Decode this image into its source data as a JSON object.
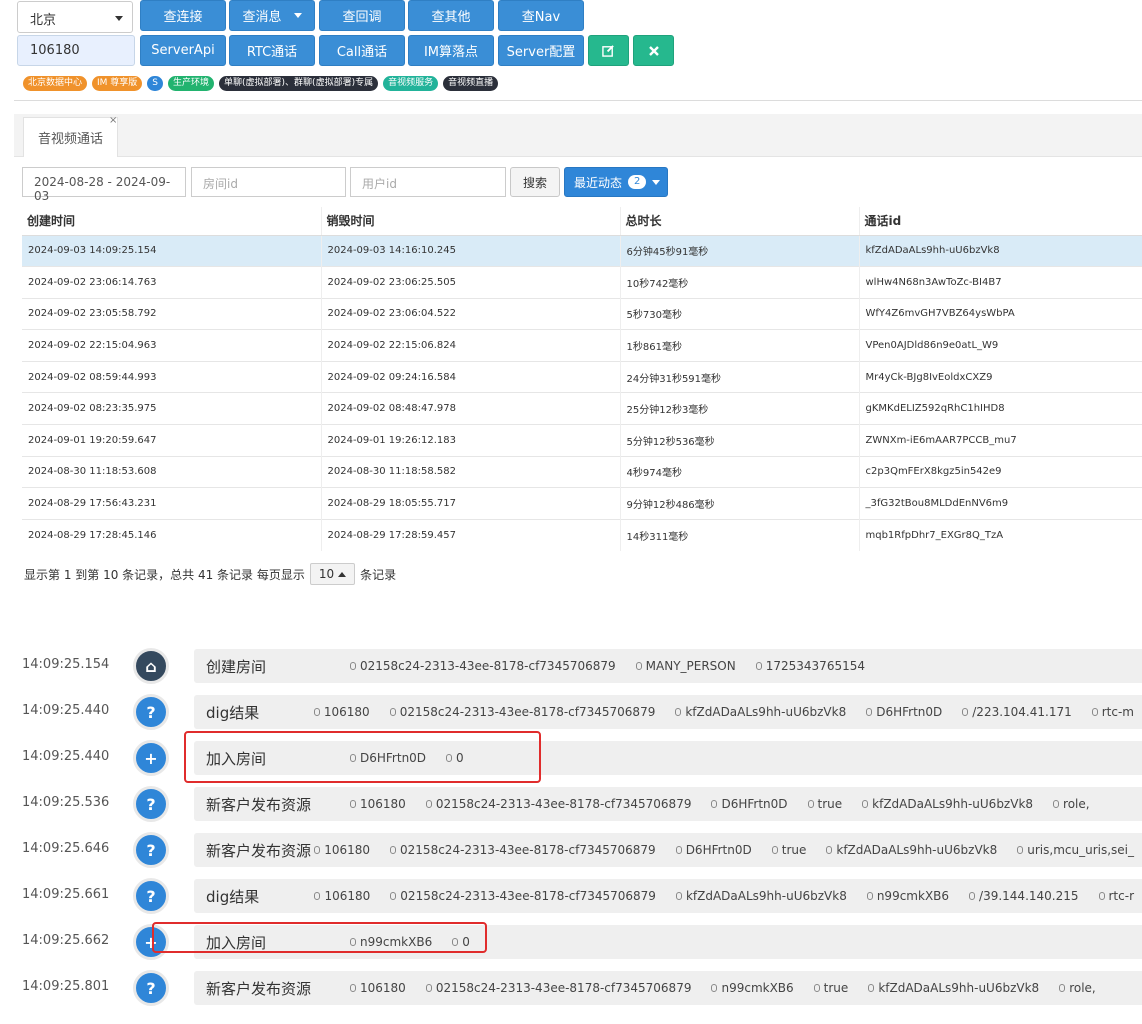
{
  "toolbar": {
    "region": "北京",
    "app_id": "106180",
    "row1_buttons": [
      "查连接",
      "查消息",
      "查回调",
      "查其他",
      "查Nav"
    ],
    "row2_buttons": [
      "ServerApi",
      "RTC通话",
      "Call通话",
      "IM算落点",
      "Server配置"
    ],
    "edit_icon": "edit-icon",
    "tool_icon": "wrench-icon"
  },
  "tags": [
    {
      "text": "北京数据中心",
      "color": "#f0922b"
    },
    {
      "text": "IM 尊享版",
      "color": "#f0922b"
    },
    {
      "text": "S",
      "color": "#2f86d8"
    },
    {
      "text": "生产环境",
      "color": "#22b36f"
    },
    {
      "text": "单聊(虚拟部署)、群聊(虚拟部署)专属",
      "color": "#2b2f3a"
    },
    {
      "text": "音视频服务",
      "color": "#22b39a"
    },
    {
      "text": "音视频直播",
      "color": "#2b2f3a"
    }
  ],
  "tab": {
    "label": "音视频通话",
    "close": "×"
  },
  "filters": {
    "date_range": "2024-08-28 - 2024-09-03",
    "room_placeholder": "房间id",
    "user_placeholder": "用户id",
    "search_label": "搜索",
    "recent_label": "最近动态",
    "recent_count": "2"
  },
  "table": {
    "headers": [
      "创建时间",
      "销毁时间",
      "总时长",
      "通话id"
    ],
    "rows": [
      [
        "2024-09-03 14:09:25.154",
        "2024-09-03 14:16:10.245",
        "6分钟45秒91毫秒",
        "kfZdADaALs9hh-uU6bzVk8"
      ],
      [
        "2024-09-02 23:06:14.763",
        "2024-09-02 23:06:25.505",
        "10秒742毫秒",
        "wlHw4N68n3AwToZc-BI4B7"
      ],
      [
        "2024-09-02 23:05:58.792",
        "2024-09-02 23:06:04.522",
        "5秒730毫秒",
        "WfY4Z6mvGH7VBZ64ysWbPA"
      ],
      [
        "2024-09-02 22:15:04.963",
        "2024-09-02 22:15:06.824",
        "1秒861毫秒",
        "VPen0AJDld86n9e0atL_W9"
      ],
      [
        "2024-09-02 08:59:44.993",
        "2024-09-02 09:24:16.584",
        "24分钟31秒591毫秒",
        "Mr4yCk-BJg8IvEoldxCXZ9"
      ],
      [
        "2024-09-02 08:23:35.975",
        "2024-09-02 08:48:47.978",
        "25分钟12秒3毫秒",
        "gKMKdELIZ592qRhC1hIHD8"
      ],
      [
        "2024-09-01 19:20:59.647",
        "2024-09-01 19:26:12.183",
        "5分钟12秒536毫秒",
        "ZWNXm-iE6mAAR7PCCB_mu7"
      ],
      [
        "2024-08-30 11:18:53.608",
        "2024-08-30 11:18:58.582",
        "4秒974毫秒",
        "c2p3QmFErX8kgz5in542e9"
      ],
      [
        "2024-08-29 17:56:43.231",
        "2024-08-29 18:05:55.717",
        "9分钟12秒486毫秒",
        "_3fG32tBou8MLDdEnNV6m9"
      ],
      [
        "2024-08-29 17:28:45.146",
        "2024-08-29 17:28:59.457",
        "14秒311毫秒",
        "mqb1RfpDhr7_EXGr8Q_TzA"
      ]
    ]
  },
  "pager": {
    "prefix": "显示第 1 到第 10 条记录，总共 41 条记录 每页显示",
    "page_size": "10",
    "suffix": "条记录"
  },
  "timeline": [
    {
      "time": "14:09:25.154",
      "icon": "home-icon",
      "glyph": "⌂",
      "dark": true,
      "title": "创建房间",
      "fields": [
        "02158c24-2313-43ee-8178-cf7345706879",
        "MANY_PERSON",
        "1725343765154"
      ]
    },
    {
      "time": "14:09:25.440",
      "icon": "question-icon",
      "glyph": "?",
      "dark": false,
      "title": "dig结果",
      "fields": [
        "106180",
        "02158c24-2313-43ee-8178-cf7345706879",
        "kfZdADaALs9hh-uU6bzVk8",
        "D6HFrtn0D",
        "/223.104.41.171",
        "rtc-m"
      ]
    },
    {
      "time": "14:09:25.440",
      "icon": "plus-icon",
      "glyph": "+",
      "dark": false,
      "title": "加入房间",
      "fields": [
        "D6HFrtn0D",
        "0"
      ]
    },
    {
      "time": "14:09:25.536",
      "icon": "question-icon",
      "glyph": "?",
      "dark": false,
      "title": "新客户发布资源",
      "fields": [
        "106180",
        "02158c24-2313-43ee-8178-cf7345706879",
        "D6HFrtn0D",
        "true",
        "kfZdADaALs9hh-uU6bzVk8",
        "role,"
      ]
    },
    {
      "time": "14:09:25.646",
      "icon": "question-icon",
      "glyph": "?",
      "dark": false,
      "title": "新客户发布资源",
      "fields": [
        "106180",
        "02158c24-2313-43ee-8178-cf7345706879",
        "D6HFrtn0D",
        "true",
        "kfZdADaALs9hh-uU6bzVk8",
        "uris,mcu_uris,sei_"
      ]
    },
    {
      "time": "14:09:25.661",
      "icon": "question-icon",
      "glyph": "?",
      "dark": false,
      "title": "dig结果",
      "fields": [
        "106180",
        "02158c24-2313-43ee-8178-cf7345706879",
        "kfZdADaALs9hh-uU6bzVk8",
        "n99cmkXB6",
        "/39.144.140.215",
        "rtc-r"
      ]
    },
    {
      "time": "14:09:25.662",
      "icon": "plus-icon",
      "glyph": "+",
      "dark": false,
      "title": "加入房间",
      "fields": [
        "n99cmkXB6",
        "0"
      ]
    },
    {
      "time": "14:09:25.801",
      "icon": "question-icon",
      "glyph": "?",
      "dark": false,
      "title": "新客户发布资源",
      "fields": [
        "106180",
        "02158c24-2313-43ee-8178-cf7345706879",
        "n99cmkXB6",
        "true",
        "kfZdADaALs9hh-uU6bzVk8",
        "role,"
      ]
    }
  ],
  "colors": {
    "primary": "#3a8ed6",
    "success": "#26b88e",
    "highlight": "#e02c2c",
    "selected_row": "#d9ebf7"
  }
}
